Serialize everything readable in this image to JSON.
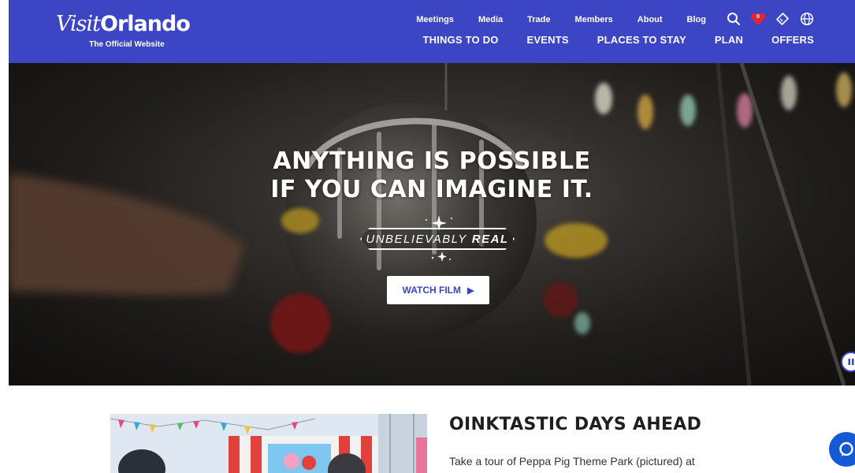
{
  "header": {
    "logo_visit": "Visit",
    "logo_orlando": "Orlando",
    "logo_sub": "The Official Website",
    "util_links": [
      "Meetings",
      "Media",
      "Trade",
      "Members",
      "About",
      "Blog"
    ],
    "util_icons": [
      "search-icon",
      "heart-icon",
      "ticket-icon",
      "globe-icon"
    ],
    "favorites_count": "0",
    "main_links": [
      "THINGS TO DO",
      "EVENTS",
      "PLACES TO STAY",
      "PLAN",
      "OFFERS"
    ]
  },
  "hero": {
    "title_line1": "ANYTHING IS POSSIBLE",
    "title_line2": "IF YOU CAN IMAGINE IT.",
    "badge_light": "UNBELIEVABLY",
    "badge_bold": "REAL",
    "watch_label": "WATCH FILM",
    "pause_icon": "pause-icon"
  },
  "article": {
    "title": "OINKTASTIC DAYS AHEAD",
    "body": "Take a tour of Peppa Pig Theme Park (pictured) at"
  },
  "colors": {
    "brand": "#3c45c4",
    "chat": "#1559d4",
    "heart": "#e0253b"
  }
}
